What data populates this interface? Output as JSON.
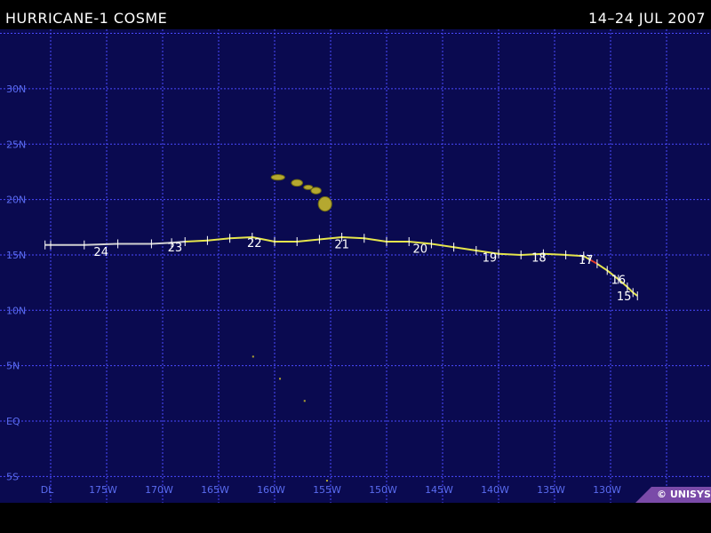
{
  "header": {
    "title": "HURRICANE-1 COSME",
    "date_range": "14–24 JUL 2007"
  },
  "footer": {
    "credit": "© UNISYS"
  },
  "colors": {
    "ocean": "#0a0a50",
    "grid": "#4a4aff",
    "land": "#b5a830",
    "track_yellow": "#e6e64c",
    "track_white": "#d2d2d2",
    "track_red": "#e23b2b",
    "credit_bg": "#7a4aa8"
  },
  "map": {
    "lat_labels": [
      {
        "lat": 30,
        "text": "30N"
      },
      {
        "lat": 25,
        "text": "25N"
      },
      {
        "lat": 20,
        "text": "20N"
      },
      {
        "lat": 15,
        "text": "15N"
      },
      {
        "lat": 10,
        "text": "10N"
      },
      {
        "lat": 5,
        "text": "5N"
      },
      {
        "lat": 0,
        "text": "EQ"
      },
      {
        "lat": -5,
        "text": "5S"
      }
    ],
    "lon_labels": [
      {
        "lon": -180,
        "text": "DL"
      },
      {
        "lon": -175,
        "text": "175W"
      },
      {
        "lon": -170,
        "text": "170W"
      },
      {
        "lon": -165,
        "text": "165W"
      },
      {
        "lon": -160,
        "text": "160W"
      },
      {
        "lon": -155,
        "text": "155W"
      },
      {
        "lon": -150,
        "text": "150W"
      },
      {
        "lon": -145,
        "text": "145W"
      },
      {
        "lon": -140,
        "text": "140W"
      },
      {
        "lon": -135,
        "text": "135W"
      },
      {
        "lon": -130,
        "text": "130W"
      }
    ],
    "day_labels": [
      {
        "lon": -128.8,
        "lat": 10.9,
        "text": "15"
      },
      {
        "lon": -129.3,
        "lat": 12.4,
        "text": "16"
      },
      {
        "lon": -132.2,
        "lat": 14.2,
        "text": "17"
      },
      {
        "lon": -136.4,
        "lat": 14.4,
        "text": "18"
      },
      {
        "lon": -140.8,
        "lat": 14.4,
        "text": "19"
      },
      {
        "lon": -147.0,
        "lat": 15.2,
        "text": "20"
      },
      {
        "lon": -154.0,
        "lat": 15.6,
        "text": "21"
      },
      {
        "lon": -161.8,
        "lat": 15.7,
        "text": "22"
      },
      {
        "lon": -168.9,
        "lat": 15.3,
        "text": "23"
      },
      {
        "lon": -175.5,
        "lat": 14.9,
        "text": "24"
      }
    ],
    "track": [
      {
        "lon": -127.6,
        "lat": 11.3,
        "stage": "storm"
      },
      {
        "lon": -128.0,
        "lat": 11.6,
        "stage": "storm"
      },
      {
        "lon": -128.5,
        "lat": 12.1,
        "stage": "storm"
      },
      {
        "lon": -129.3,
        "lat": 12.8,
        "stage": "storm"
      },
      {
        "lon": -130.3,
        "lat": 13.6,
        "stage": "storm"
      },
      {
        "lon": -131.2,
        "lat": 14.2,
        "stage": "storm"
      },
      {
        "lon": -131.9,
        "lat": 14.6,
        "stage": "hurricane"
      },
      {
        "lon": -132.4,
        "lat": 14.9,
        "stage": "storm"
      },
      {
        "lon": -134.0,
        "lat": 15.0,
        "stage": "storm"
      },
      {
        "lon": -136.0,
        "lat": 15.1,
        "stage": "storm"
      },
      {
        "lon": -138.0,
        "lat": 15.0,
        "stage": "storm"
      },
      {
        "lon": -140.0,
        "lat": 15.1,
        "stage": "storm"
      },
      {
        "lon": -142.0,
        "lat": 15.4,
        "stage": "storm"
      },
      {
        "lon": -144.0,
        "lat": 15.7,
        "stage": "storm"
      },
      {
        "lon": -146.0,
        "lat": 16.0,
        "stage": "storm"
      },
      {
        "lon": -148.0,
        "lat": 16.2,
        "stage": "storm"
      },
      {
        "lon": -150.0,
        "lat": 16.2,
        "stage": "storm"
      },
      {
        "lon": -152.0,
        "lat": 16.5,
        "stage": "storm"
      },
      {
        "lon": -154.0,
        "lat": 16.6,
        "stage": "storm"
      },
      {
        "lon": -156.0,
        "lat": 16.4,
        "stage": "storm"
      },
      {
        "lon": -158.0,
        "lat": 16.2,
        "stage": "storm"
      },
      {
        "lon": -160.0,
        "lat": 16.2,
        "stage": "storm"
      },
      {
        "lon": -162.0,
        "lat": 16.6,
        "stage": "storm"
      },
      {
        "lon": -164.0,
        "lat": 16.5,
        "stage": "storm"
      },
      {
        "lon": -166.0,
        "lat": 16.3,
        "stage": "storm"
      },
      {
        "lon": -168.0,
        "lat": 16.2,
        "stage": "storm"
      },
      {
        "lon": -169.2,
        "lat": 16.1,
        "stage": "depression"
      },
      {
        "lon": -171.0,
        "lat": 16.0,
        "stage": "depression"
      },
      {
        "lon": -174.0,
        "lat": 16.0,
        "stage": "depression"
      },
      {
        "lon": -177.0,
        "lat": 15.9,
        "stage": "depression"
      },
      {
        "lon": -180.0,
        "lat": 15.9,
        "stage": "depression"
      },
      {
        "lon": -180.5,
        "lat": 15.9,
        "stage": "depression"
      }
    ],
    "islands": [
      {
        "name": "niihau-kauai",
        "lon": -159.7,
        "lat": 22.0,
        "rx": 0.6,
        "ry": 0.25
      },
      {
        "name": "oahu",
        "lon": -158.0,
        "lat": 21.5,
        "rx": 0.5,
        "ry": 0.3
      },
      {
        "name": "molokai",
        "lon": -157.0,
        "lat": 21.1,
        "rx": 0.4,
        "ry": 0.2
      },
      {
        "name": "maui",
        "lon": -156.3,
        "lat": 20.8,
        "rx": 0.45,
        "ry": 0.3
      },
      {
        "name": "big-island",
        "lon": -155.5,
        "lat": 19.6,
        "rx": 0.6,
        "ry": 0.65
      }
    ],
    "specks": [
      {
        "lon": -162.0,
        "lat": 5.9
      },
      {
        "lon": -159.6,
        "lat": 3.9
      },
      {
        "lon": -157.4,
        "lat": 1.9
      },
      {
        "lon": -155.4,
        "lat": -5.3
      }
    ]
  }
}
